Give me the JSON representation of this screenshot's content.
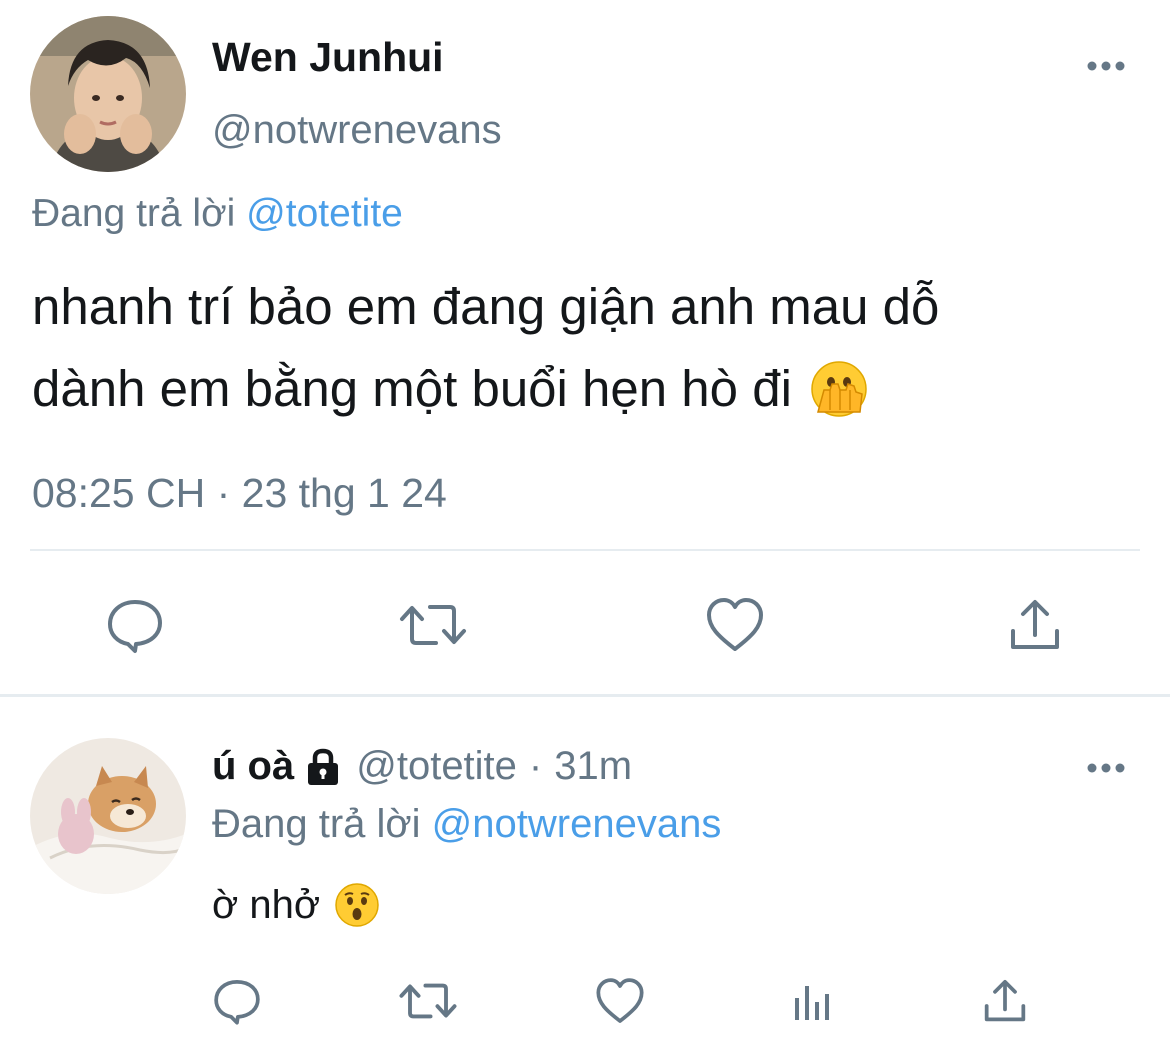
{
  "main_tweet": {
    "display_name": "Wen Junhui",
    "handle": "@notwrenevans",
    "reply_prefix": "Đang trả lời",
    "reply_mention": "@totetite",
    "text_line1": "nhanh trí bảo em đang giận anh mau dỗ",
    "text_line2": "dành em bằng một buổi hẹn hò đi",
    "text_emoji": "face-with-open-eyes-and-hand-over-mouth",
    "timestamp": "08:25 CH · 23 thg 1 24",
    "actions": [
      "reply-icon",
      "retweet-icon",
      "like-icon",
      "share-icon"
    ]
  },
  "reply_tweet": {
    "display_name": "ú oà",
    "handle": "@totetite",
    "separator": "·",
    "time": "31m",
    "reply_prefix": "Đang trả lời",
    "reply_mention": "@notwrenevans",
    "text": "ờ nhở",
    "text_emoji": "hushed-face",
    "actions": [
      "reply-icon",
      "retweet-icon",
      "like-icon",
      "analytics-icon",
      "share-icon"
    ]
  },
  "colors": {
    "text": "#14171a",
    "secondary": "#657786",
    "link": "#4a9ee8",
    "divider": "#e6ecf0",
    "icon": "#657786"
  }
}
